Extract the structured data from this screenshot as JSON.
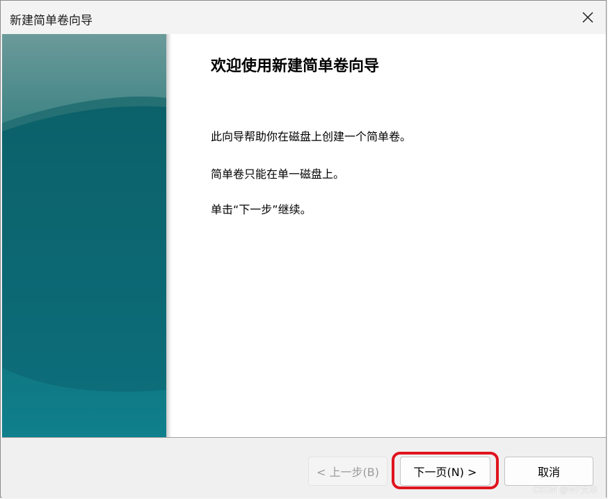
{
  "window": {
    "title": "新建简单卷向导",
    "close_icon": "close-icon"
  },
  "main": {
    "heading": "欢迎使用新建简单卷向导",
    "paragraphs": [
      "此向导帮助你在磁盘上创建一个简单卷。",
      "简单卷只能在单一磁盘上。",
      "单击“下一步”继续。"
    ]
  },
  "footer": {
    "back_label": "< 上一步(B)",
    "next_label": "下一页(N) >",
    "cancel_label": "取消"
  },
  "watermark": "CSDN @WF文丰",
  "colors": {
    "side_panel": "#116a72",
    "highlight": "#e0141e",
    "disabled_text": "#9a9a9a"
  }
}
